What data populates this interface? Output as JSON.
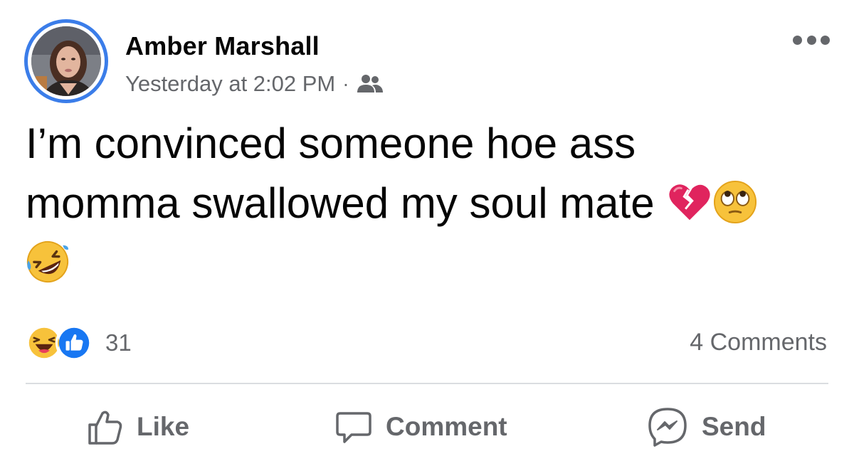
{
  "post": {
    "author": "Amber Marshall",
    "timestamp": "Yesterday at 2:02 PM",
    "separator": "·",
    "audience_icon": "friends-icon",
    "text_line1": "I’m convinced someone hoe ass",
    "text_line2": "momma swallowed my soul mate",
    "emojis": [
      "broken-heart-icon",
      "eye-roll-icon",
      "rofl-icon"
    ]
  },
  "reactions": {
    "icons": [
      "haha-icon",
      "like-icon"
    ],
    "count": "31",
    "comments": "4 Comments"
  },
  "actions": {
    "like": "Like",
    "comment": "Comment",
    "send": "Send"
  },
  "colors": {
    "accent": "#3b7de9",
    "like_blue": "#1877f2",
    "muted": "#65676b",
    "text": "#050505",
    "divider": "#dadde1"
  }
}
